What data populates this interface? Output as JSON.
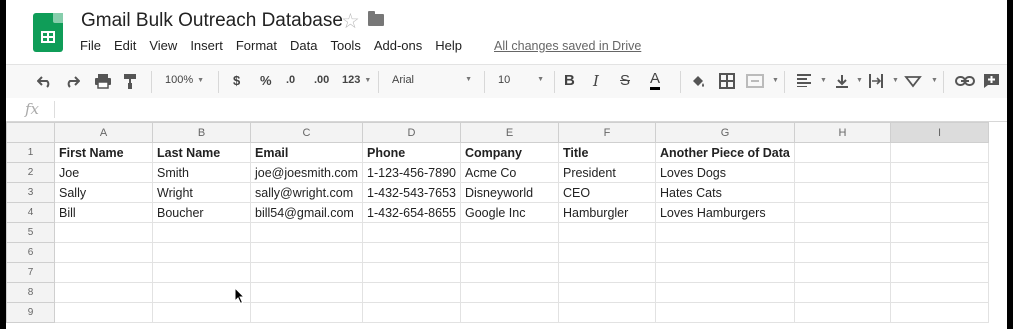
{
  "header": {
    "title": "Gmail Bulk Outreach Database",
    "star": "☆",
    "menu": [
      "File",
      "Edit",
      "View",
      "Insert",
      "Format",
      "Data",
      "Tools",
      "Add-ons",
      "Help"
    ],
    "save_status": "All changes saved in Drive"
  },
  "toolbar": {
    "zoom": "100%",
    "currency": "$",
    "percent": "%",
    "decrease_decimals": ".0",
    "increase_decimals": ".00",
    "more_formats": "123",
    "font": "Arial",
    "font_size": "10",
    "bold": "B",
    "italic": "I",
    "strikethrough": "S",
    "text_color": "A"
  },
  "formula_bar": {
    "label": "fx",
    "value": ""
  },
  "columns": [
    "A",
    "B",
    "C",
    "D",
    "E",
    "F",
    "G",
    "H",
    "I"
  ],
  "rows": [
    {
      "n": "1",
      "cells": [
        "First Name",
        "Last Name",
        "Email",
        "Phone",
        "Company",
        "Title",
        "Another Piece of Data",
        "",
        ""
      ]
    },
    {
      "n": "2",
      "cells": [
        "Joe",
        "Smith",
        "joe@joesmith.com",
        "1-123-456-7890",
        "Acme Co",
        "President",
        "Loves Dogs",
        "",
        ""
      ]
    },
    {
      "n": "3",
      "cells": [
        "Sally",
        "Wright",
        "sally@wright.com",
        "1-432-543-7653",
        "Disneyworld",
        "CEO",
        "Hates Cats",
        "",
        ""
      ]
    },
    {
      "n": "4",
      "cells": [
        "Bill",
        "Boucher",
        "bill54@gmail.com",
        "1-432-654-8655",
        "Google Inc",
        "Hamburgler",
        "Loves Hamburgers",
        "",
        ""
      ]
    },
    {
      "n": "5",
      "cells": [
        "",
        "",
        "",
        "",
        "",
        "",
        "",
        "",
        ""
      ]
    },
    {
      "n": "6",
      "cells": [
        "",
        "",
        "",
        "",
        "",
        "",
        "",
        "",
        ""
      ]
    },
    {
      "n": "7",
      "cells": [
        "",
        "",
        "",
        "",
        "",
        "",
        "",
        "",
        ""
      ]
    },
    {
      "n": "8",
      "cells": [
        "",
        "",
        "",
        "",
        "",
        "",
        "",
        "",
        ""
      ]
    },
    {
      "n": "9",
      "cells": [
        "",
        "",
        "",
        "",
        "",
        "",
        "",
        "",
        ""
      ]
    }
  ],
  "colors": {
    "sheets_green": "#0f9d58",
    "header_bg": "#f3f3f3",
    "gridline": "#e2e2e2"
  }
}
